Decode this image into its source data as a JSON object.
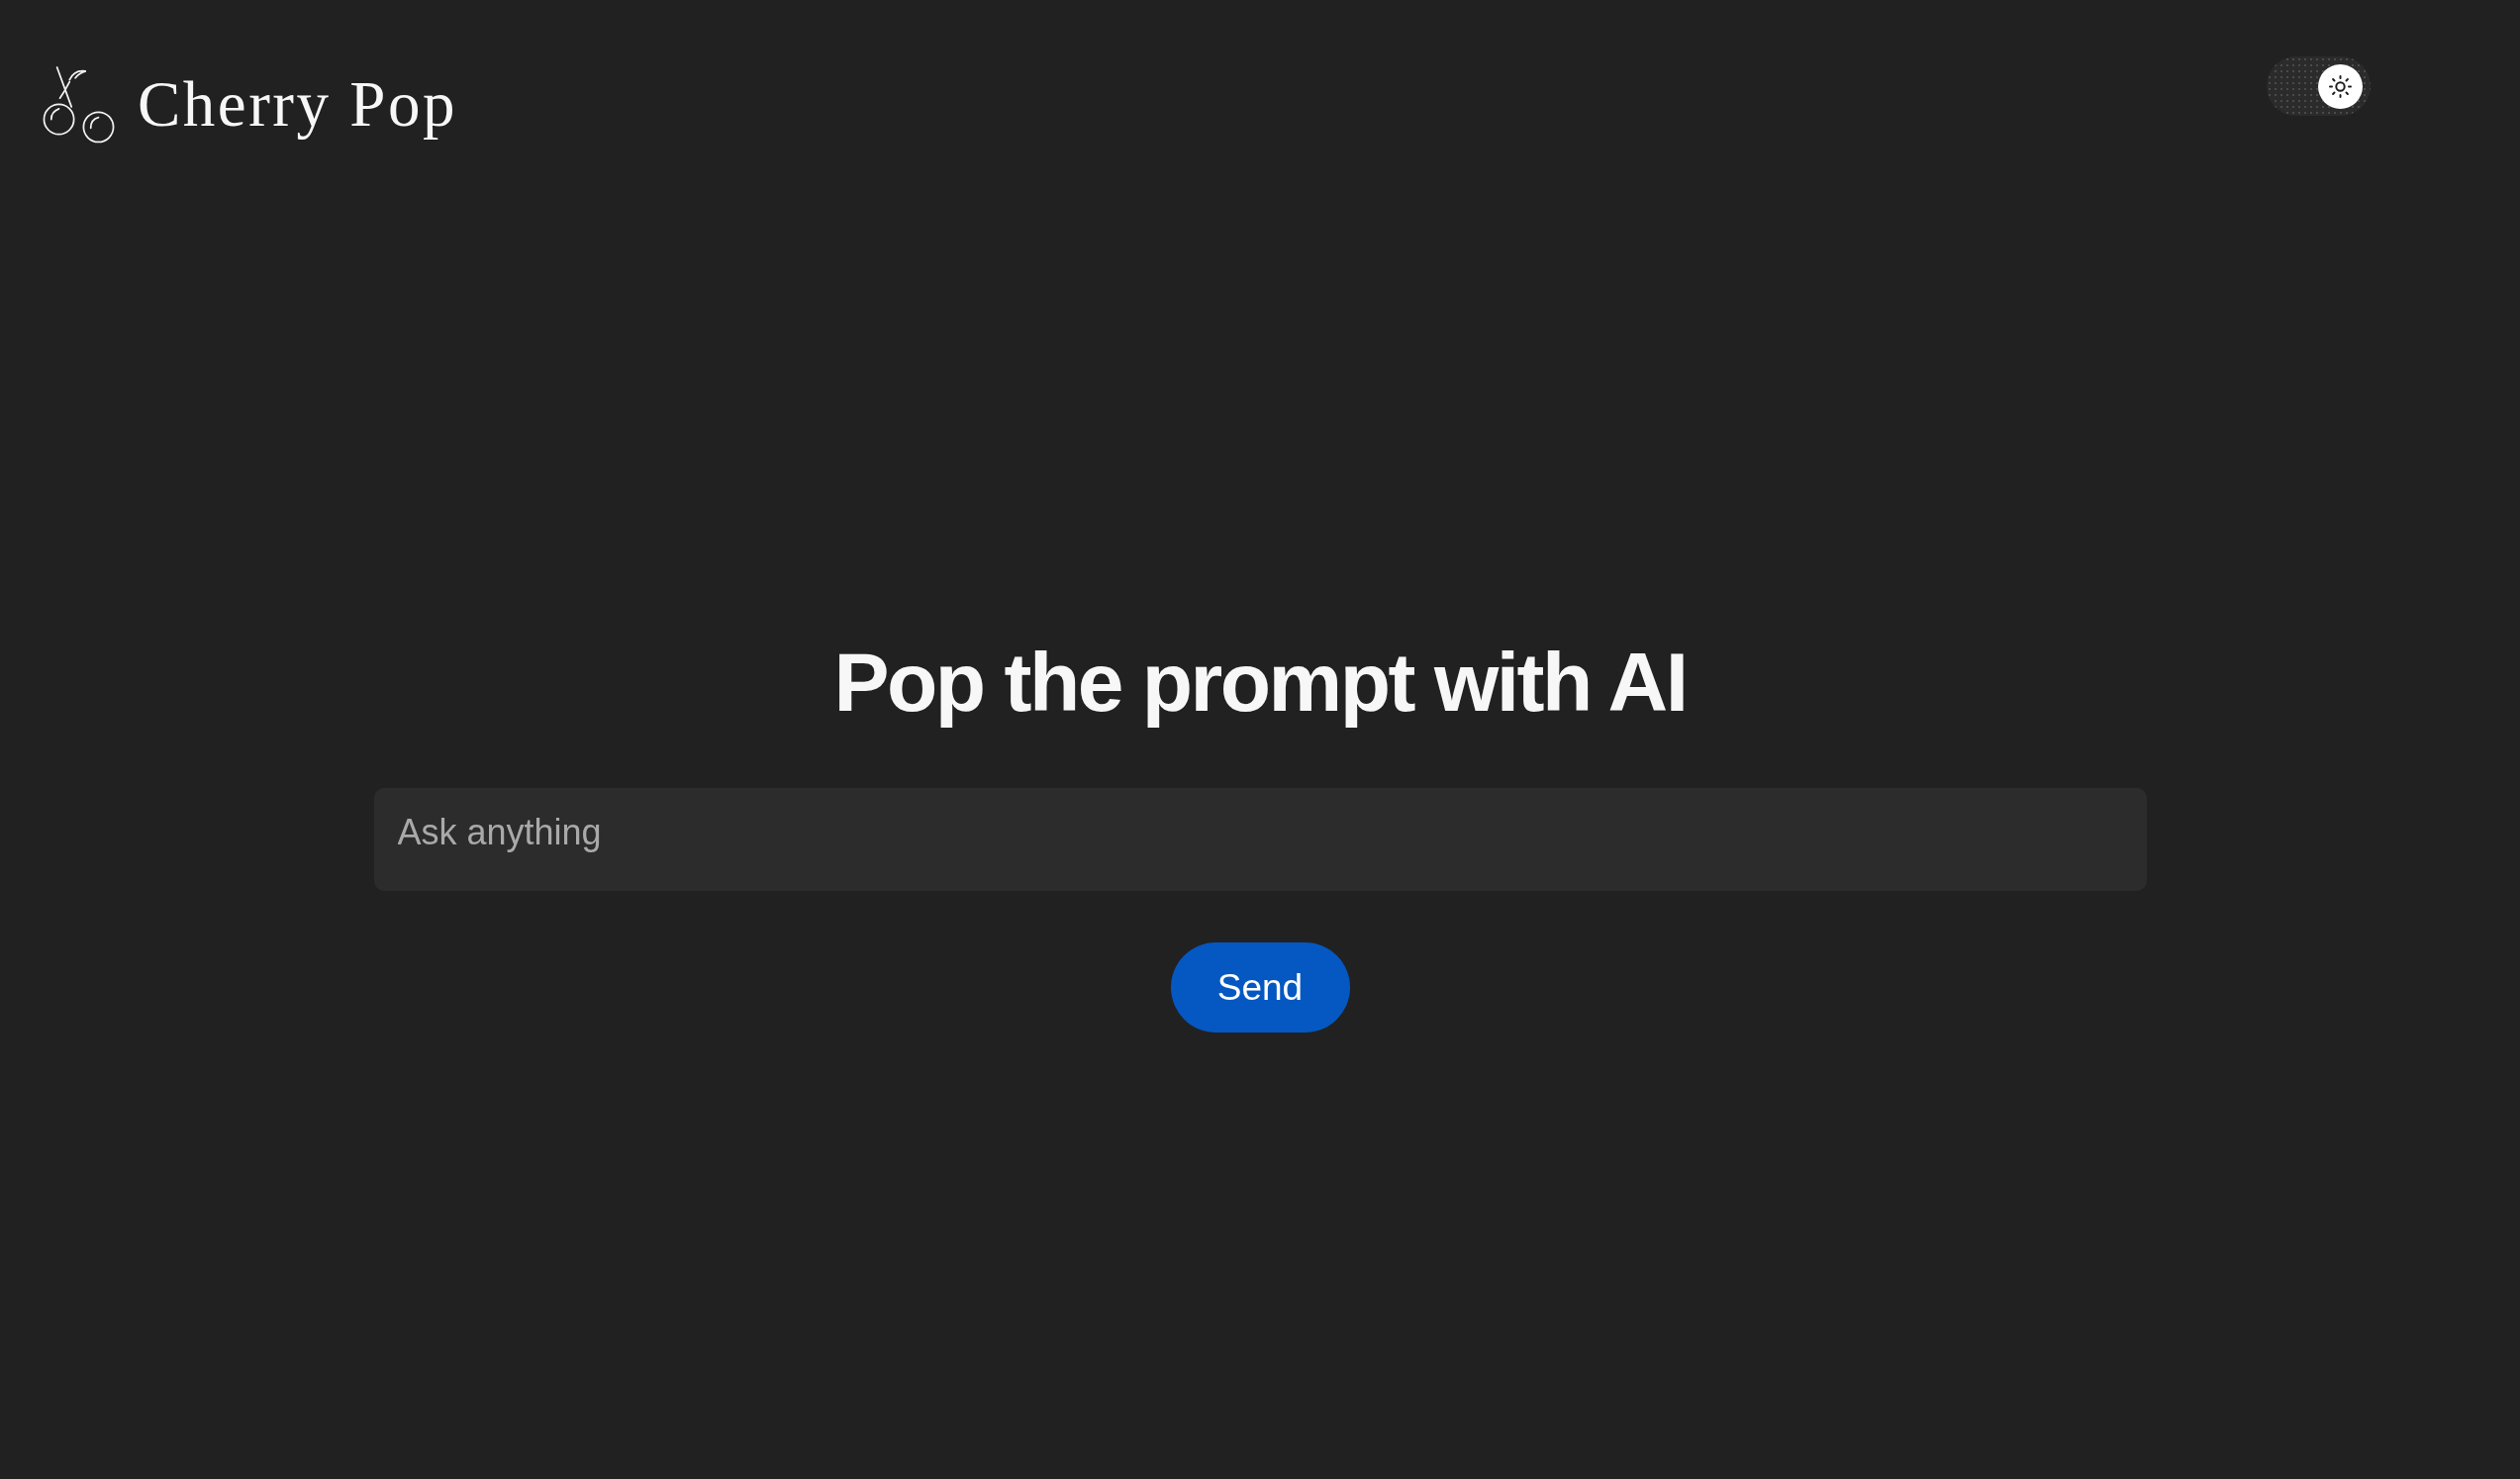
{
  "header": {
    "logo": {
      "text": "Cherry Pop"
    },
    "theme_toggle": {
      "on": true
    }
  },
  "main": {
    "heading": "Pop the prompt with AI",
    "prompt_field": {
      "placeholder": "Ask anything"
    },
    "send_button": {
      "label": "Send"
    }
  }
}
